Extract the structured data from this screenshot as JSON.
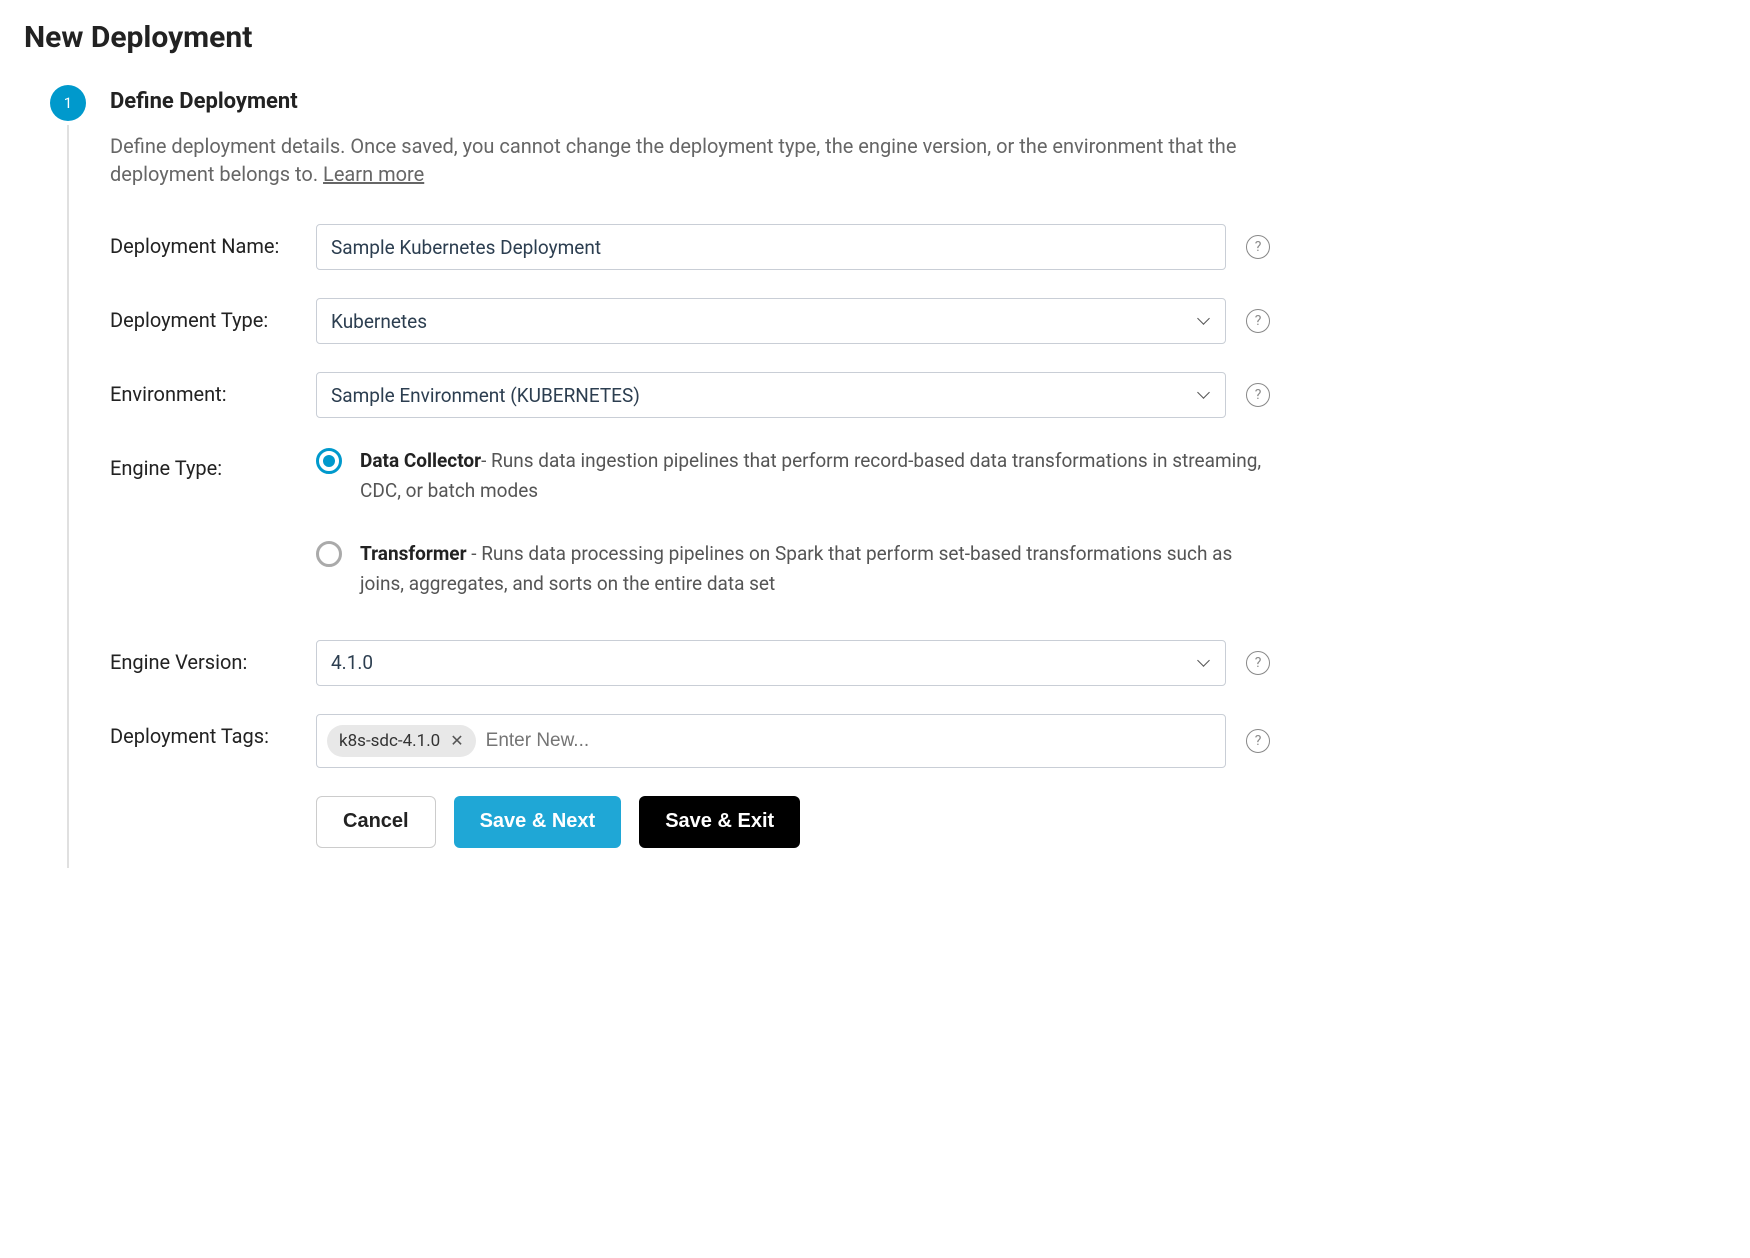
{
  "page": {
    "title": "New Deployment"
  },
  "step": {
    "number": "1",
    "title": "Define Deployment",
    "description_prefix": "Define deployment details. Once saved, you cannot change the deployment type, the engine version, or the environment that the deployment belongs to. ",
    "learn_more": "Learn more"
  },
  "form": {
    "name_label": "Deployment Name:",
    "name_value": "Sample Kubernetes Deployment",
    "type_label": "Deployment Type:",
    "type_value": "Kubernetes",
    "env_label": "Environment:",
    "env_value": "Sample Environment (KUBERNETES)",
    "engine_type_label": "Engine Type:",
    "engine_options": {
      "data_collector": {
        "name": "Data Collector",
        "desc": "- Runs data ingestion pipelines that perform record-based data transformations in streaming, CDC, or batch modes"
      },
      "transformer": {
        "name": "Transformer",
        "desc": " - Runs data processing pipelines on Spark that perform set-based transformations such as joins, aggregates, and sorts on the entire data set"
      }
    },
    "version_label": "Engine Version:",
    "version_value": "4.1.0",
    "tags_label": "Deployment Tags:",
    "tag_value": "k8s-sdc-4.1.0",
    "tag_placeholder": "Enter New..."
  },
  "buttons": {
    "cancel": "Cancel",
    "save_next": "Save & Next",
    "save_exit": "Save & Exit"
  }
}
